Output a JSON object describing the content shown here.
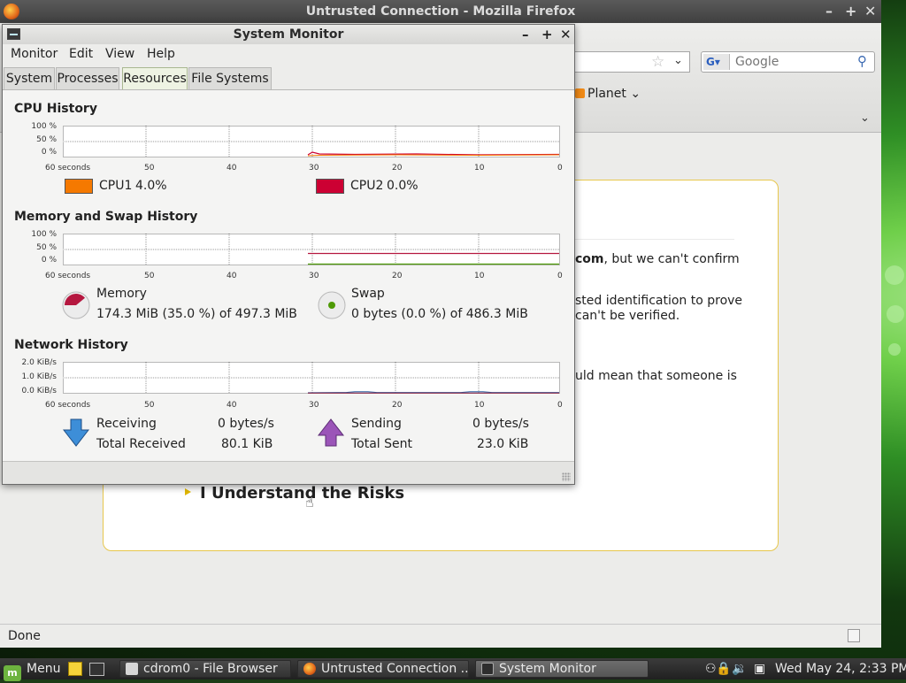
{
  "firefox": {
    "title": "Untrusted Connection - Mozilla Firefox",
    "search_placeholder": "Google",
    "bookmark": "Planet",
    "status": "Done",
    "error_lines": [
      {
        "bold": "com",
        "rest": ", but we can't confirm"
      },
      {
        "text": "sted identification to prove"
      },
      {
        "text": " can't be verified."
      },
      {
        "text": "uld mean that someone is"
      }
    ],
    "risks_link": "I Understand the Risks"
  },
  "system_monitor": {
    "title": "System Monitor",
    "menu": [
      "Monitor",
      "Edit",
      "View",
      "Help"
    ],
    "tabs": [
      "System",
      "Processes",
      "Resources",
      "File Systems"
    ],
    "active_tab": "Resources",
    "cpu": {
      "title": "CPU History",
      "y_labels": [
        "100 %",
        "50 %",
        "0 %"
      ],
      "x_labels": [
        "60 seconds",
        "50",
        "40",
        "30",
        "20",
        "10",
        "0"
      ],
      "cpu1": {
        "label": "CPU1",
        "value": "4.0%",
        "color": "#f57900"
      },
      "cpu2": {
        "label": "CPU2",
        "value": "0.0%",
        "color": "#cc0033"
      }
    },
    "memory": {
      "title": "Memory and Swap History",
      "y_labels": [
        "100 %",
        "50 %",
        "0 %"
      ],
      "x_labels": [
        "60 seconds",
        "50",
        "40",
        "30",
        "20",
        "10",
        "0"
      ],
      "memory_label": "Memory",
      "memory_value": "174.3 MiB (35.0 %) of 497.3 MiB",
      "swap_label": "Swap",
      "swap_value": "0 bytes (0.0 %) of 486.3 MiB",
      "memory_color": "#b5173f",
      "swap_color": "#4e9a06"
    },
    "network": {
      "title": "Network History",
      "y_labels": [
        "2.0 KiB/s",
        "1.0 KiB/s",
        "0.0 KiB/s"
      ],
      "x_labels": [
        "60 seconds",
        "50",
        "40",
        "30",
        "20",
        "10",
        "0"
      ],
      "receiving_label": "Receiving",
      "receiving_value": "0 bytes/s",
      "total_received_label": "Total Received",
      "total_received_value": "80.1 KiB",
      "sending_label": "Sending",
      "sending_value": "0 bytes/s",
      "total_sent_label": "Total Sent",
      "total_sent_value": "23.0 KiB"
    }
  },
  "taskbar": {
    "menu": "Menu",
    "tasks": [
      "cdrom0 - File Browser",
      "Untrusted Connection ...",
      "System Monitor"
    ],
    "active_task": "System Monitor",
    "clock": "Wed May 24,  2:33 PM"
  }
}
